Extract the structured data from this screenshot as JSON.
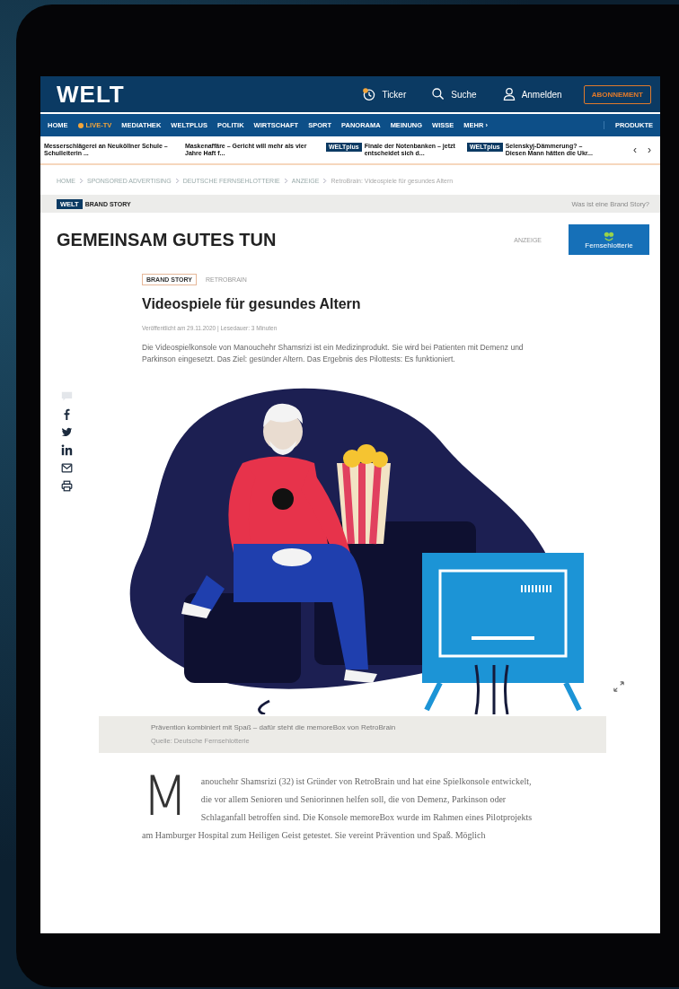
{
  "header": {
    "logo": "WELT",
    "actions": [
      {
        "kind": "ticker",
        "label": "Ticker"
      },
      {
        "kind": "search",
        "label": "Suche"
      },
      {
        "kind": "login",
        "label": "Anmelden"
      }
    ],
    "subscribe": "ABONNEMENT"
  },
  "nav": {
    "items": [
      {
        "label": "HOME",
        "live": false
      },
      {
        "label": "LIVE-TV",
        "live": true
      },
      {
        "label": "MEDIATHEK",
        "live": false
      },
      {
        "label": "WELTPLUS",
        "live": false
      },
      {
        "label": "POLITIK",
        "live": false
      },
      {
        "label": "WIRTSCHAFT",
        "live": false
      },
      {
        "label": "SPORT",
        "live": false
      },
      {
        "label": "PANORAMA",
        "live": false
      },
      {
        "label": "MEINUNG",
        "live": false
      },
      {
        "label": "WISSE",
        "live": false
      },
      {
        "label": "MEHR ›",
        "live": false
      }
    ],
    "products": "PRODUKTE"
  },
  "ticker": {
    "items": [
      {
        "text": "Messerschlägerei an Neuköllner Schule – Schulleiterin ..."
      },
      {
        "text": "Maskenaffäre – Gericht will mehr als vier Jahre Haft f..."
      },
      {
        "badge": "WELTplus",
        "text": "Finale der Notenbanken – jetzt entscheidet sich d..."
      },
      {
        "badge": "WELTplus",
        "text": "Selenskyj-Dämmerung? – Diesen Mann hätten die Ukr..."
      }
    ],
    "prev": "‹",
    "next": "›"
  },
  "breadcrumb": [
    "HOME",
    "SPONSORED ADVERTISING",
    "DEUTSCHE FERNSEHLOTTERIE",
    "ANZEIGE",
    "RetroBrain: Videospiele für gesundes Altern"
  ],
  "brand_bar": {
    "badge": "WELT",
    "label": "BRAND STORY",
    "link": "Was ist eine Brand Story?"
  },
  "section": {
    "title": "GEMEINSAM GUTES TUN",
    "ad_label": "ANZEIGE",
    "sponsor": "Fernsehlotterie"
  },
  "article": {
    "tag": "BRAND STORY",
    "kicker": "RETROBRAIN",
    "title": "Videospiele für gesundes Altern",
    "meta": "Veröffentlicht am 29.11.2020 | Lesedauer: 3 Minuten",
    "lead": "Die Videospielkonsole von Manouchehr Shamsrizi ist ein Medizinprodukt. Sie wird bei Patienten mit Demenz und Parkinson eingesetzt. Das Ziel: gesünder Altern. Das Ergebnis des Pilottests: Es funktioniert.",
    "caption": "Prävention kombiniert mit Spaß – dafür steht die memoreBox von RetroBrain",
    "credit": "Quelle: Deutsche Fernsehlotterie",
    "body": "Manouchehr Shamsrizi (32) ist Gründer von RetroBrain und hat eine Spielkonsole entwickelt, die vor allem Senioren und Seniorinnen helfen soll, die von Demenz, Parkinson oder Schlaganfall betroffen sind. Die Konsole memoreBox wurde im Rahmen eines Pilotprojekts am Hamburger Hospital zum Heiligen Geist getestet. Sie vereint Prävention und Spaß. Möglich"
  },
  "share": [
    {
      "kind": "comment"
    },
    {
      "kind": "facebook"
    },
    {
      "kind": "twitter"
    },
    {
      "kind": "linkedin"
    },
    {
      "kind": "mail"
    },
    {
      "kind": "print"
    }
  ]
}
